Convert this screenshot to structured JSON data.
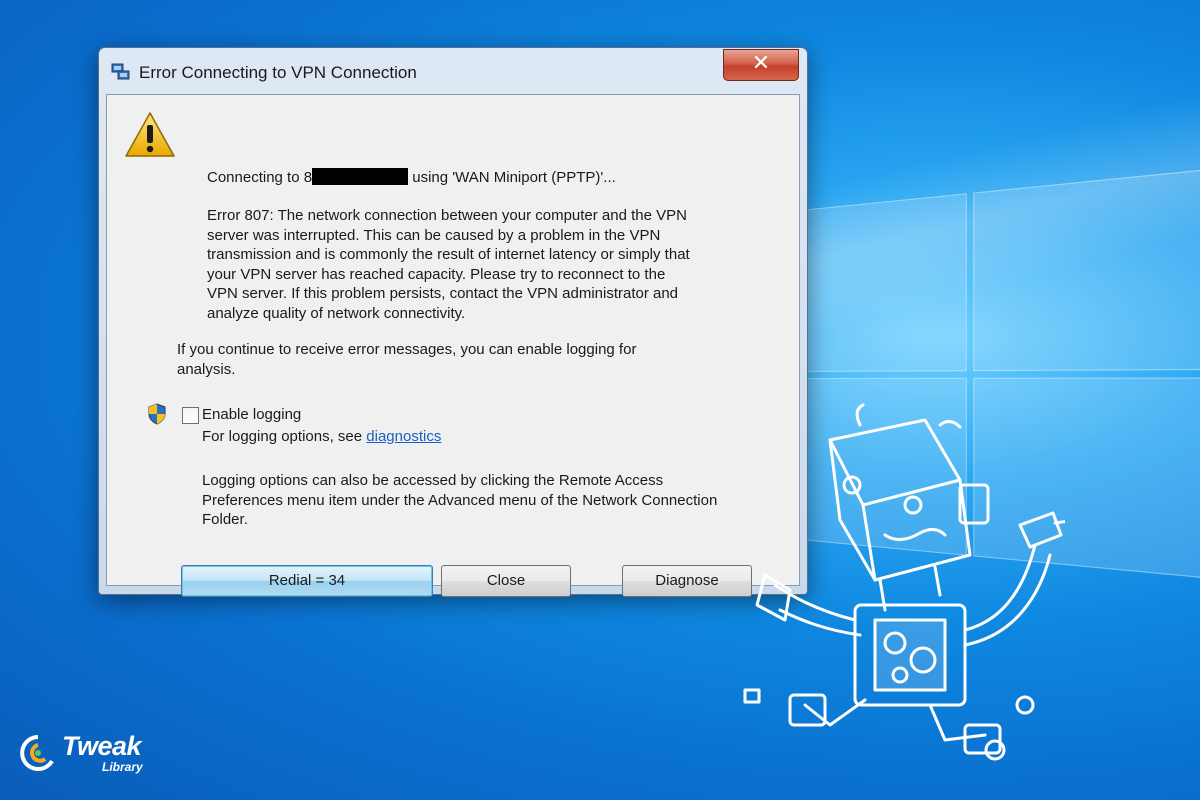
{
  "dialog": {
    "title": "Error Connecting to VPN Connection",
    "close_glyph": "✕",
    "connecting_prefix": "Connecting to 8",
    "connecting_suffix": "using 'WAN Miniport (PPTP)'...",
    "error_lines": [
      "Error 807: The network connection between your computer and the VPN",
      "server was interrupted.  This can be caused by a problem in the VPN",
      "transmission and is commonly the result of internet latency or simply that",
      "your VPN server has reached capacity.  Please try to reconnect to the",
      "VPN server.  If this problem persists, contact the VPN administrator and",
      "analyze quality of network connectivity."
    ],
    "logging_hint_lines": [
      "If you continue to receive error messages, you can enable logging for",
      "analysis."
    ],
    "enable_logging_label": "Enable logging",
    "enable_logging_checked": false,
    "logging_options_prefix": "For logging options, see ",
    "diagnostics_link": "diagnostics",
    "access_lines": [
      "Logging options can also be accessed by clicking the Remote Access",
      "Preferences menu item under the Advanced menu of the Network Connection",
      "Folder."
    ],
    "buttons": {
      "redial": "Redial = 34",
      "close": "Close",
      "diagnose": "Diagnose"
    }
  },
  "branding": {
    "word": "Tweak",
    "sub": "Library"
  },
  "colors": {
    "desktop_blue": "#0e87e0",
    "link_blue": "#1c5fc4",
    "close_red": "#c3402a"
  }
}
